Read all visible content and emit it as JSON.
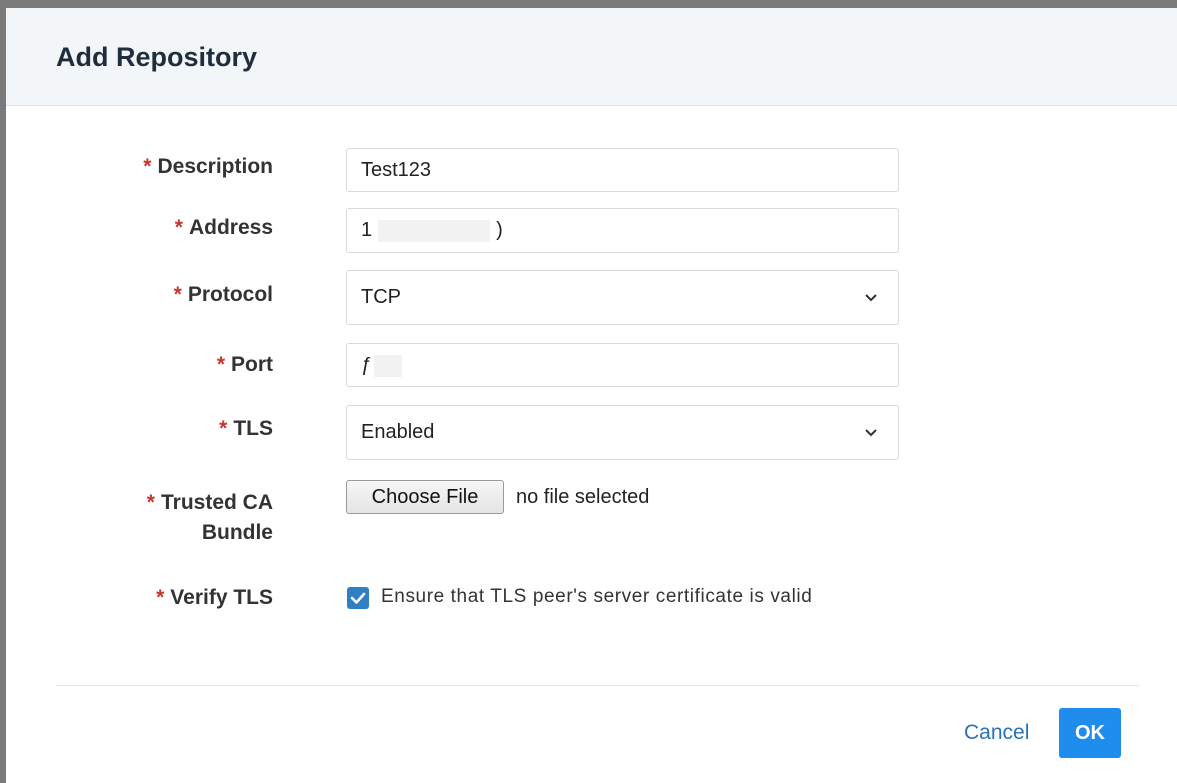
{
  "dialog": {
    "title": "Add Repository"
  },
  "required_marker": "*",
  "fields": {
    "description": {
      "label": "Description",
      "value": "Test123"
    },
    "address": {
      "label": "Address",
      "value_prefix": "1",
      "value_suffix": ")"
    },
    "protocol": {
      "label": "Protocol",
      "selected": "TCP"
    },
    "port": {
      "label": "Port",
      "value_prefix": "ƒ"
    },
    "tls": {
      "label": "TLS",
      "selected": "Enabled"
    },
    "ca_bundle": {
      "label_line1": "Trusted CA",
      "label_line2": "Bundle",
      "button": "Choose File",
      "status": "no file selected"
    },
    "verify_tls": {
      "label": "Verify TLS",
      "checked": true,
      "text": "Ensure that TLS peer's server certificate is valid"
    }
  },
  "footer": {
    "cancel": "Cancel",
    "ok": "OK"
  },
  "colors": {
    "accent": "#1f8ded",
    "required": "#c7362b",
    "link": "#2873b8"
  },
  "icons": {
    "select_chevron": "chevron-down-icon",
    "checkbox": "checkmark-icon"
  }
}
